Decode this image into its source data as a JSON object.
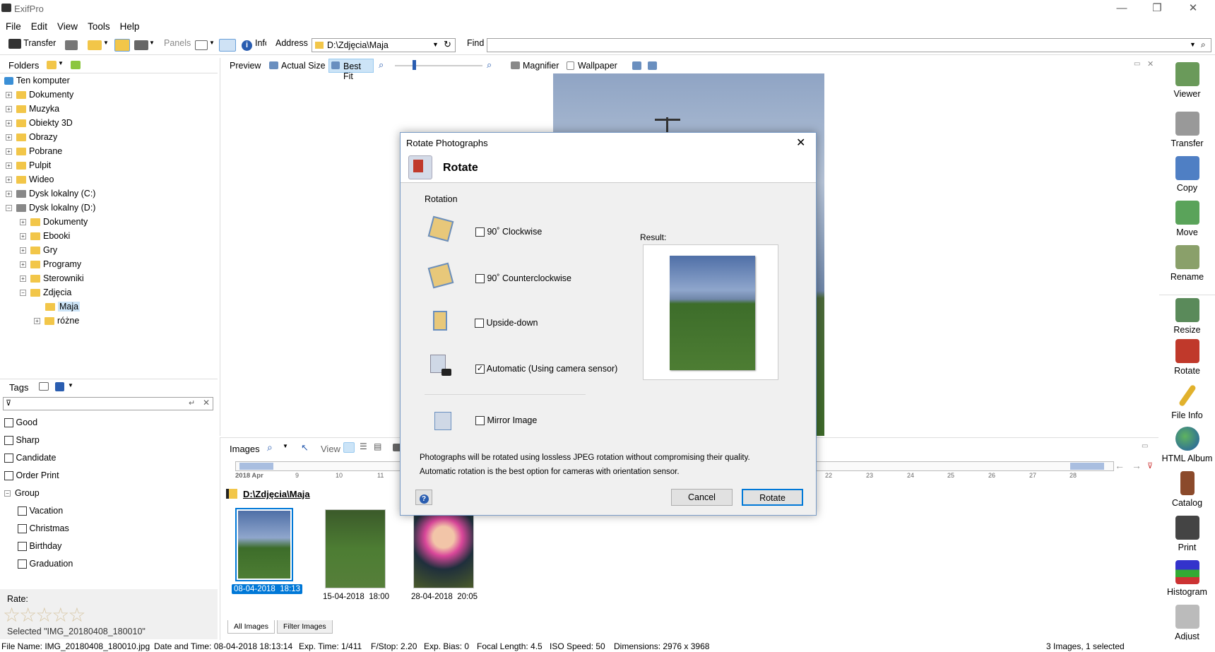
{
  "window": {
    "title": "ExifPro"
  },
  "menu": [
    "File",
    "Edit",
    "View",
    "Tools",
    "Help"
  ],
  "toolbar": {
    "transfer": "Transfer",
    "panels": "Panels",
    "info": "Info",
    "address_label": "Address",
    "address_value": "D:\\Zdjęcia\\Maja",
    "find_label": "Find",
    "find_value": ""
  },
  "folders": {
    "title": "Folders",
    "items": [
      "Ten komputer",
      "Dokumenty",
      "Muzyka",
      "Obiekty 3D",
      "Obrazy",
      "Pobrane",
      "Pulpit",
      "Wideo",
      "Dysk lokalny (C:)",
      "Dysk lokalny (D:)",
      "Dokumenty",
      "Ebooki",
      "Gry",
      "Programy",
      "Sterowniki",
      "Zdjęcia",
      "Maja",
      "różne"
    ]
  },
  "tags": {
    "title": "Tags",
    "filter_value": "",
    "items": [
      "Good",
      "Sharp",
      "Candidate",
      "Order Print"
    ],
    "group_label": "Group",
    "group_items": [
      "Vacation",
      "Christmas",
      "Birthday",
      "Graduation"
    ]
  },
  "rate": {
    "label": "Rate:",
    "stars": 0,
    "max": 5,
    "selected_text": "Selected \"IMG_20180408_180010\""
  },
  "preview": {
    "tab": "Preview",
    "actual_size": "Actual Size",
    "best_fit": "Best Fit",
    "magnifier": "Magnifier",
    "wallpaper": "Wallpaper"
  },
  "images": {
    "title": "Images",
    "view": "View",
    "timeline_month": "2018 Apr",
    "timeline_days": [
      "9",
      "10",
      "11",
      "22",
      "23",
      "24",
      "25",
      "26",
      "27",
      "28"
    ],
    "folder": "D:\\Zdjęcia\\Maja",
    "thumbs": [
      {
        "label": "08-04-2018  18:13",
        "selected": true
      },
      {
        "label": "15-04-2018  18:00",
        "selected": false
      },
      {
        "label": "28-04-2018  20:05",
        "selected": false
      }
    ],
    "tabs": [
      "All Images",
      "Filter Images"
    ]
  },
  "sidebar_right": [
    "Viewer",
    "Transfer",
    "Copy",
    "Move",
    "Rename",
    "Resize",
    "Rotate",
    "File Info",
    "HTML Album",
    "Catalog",
    "Print",
    "Histogram",
    "Adjust"
  ],
  "dialog": {
    "title": "Rotate Photographs",
    "header": "Rotate",
    "section": "Rotation",
    "options": [
      {
        "label": "90˚ Clockwise",
        "checked": false
      },
      {
        "label": "90˚ Counterclockwise",
        "checked": false
      },
      {
        "label": "Upside-down",
        "checked": false
      },
      {
        "label": "Automatic (Using camera sensor)",
        "checked": true
      },
      {
        "label": "Mirror Image",
        "checked": false
      }
    ],
    "result_label": "Result:",
    "note1": "Photographs will be rotated using lossless JPEG rotation without compromising their quality.",
    "note2": "Automatic rotation is the best option for cameras with orientation sensor.",
    "help": "?",
    "cancel": "Cancel",
    "rotate": "Rotate"
  },
  "status": {
    "file_name": "File Name: IMG_20180408_180010.jpg",
    "date_time": "Date and Time: 08-04-2018  18:13:14",
    "exp_time": "Exp. Time: 1/411",
    "fstop": "F/Stop: 2.20",
    "exp_bias": "Exp. Bias: 0",
    "focal": "Focal Length: 4.5",
    "iso": "ISO Speed: 50",
    "dimensions": "Dimensions: 2976 x 3968",
    "count": "3 Images, 1 selected"
  },
  "colors": {
    "selection": "#0078d7",
    "folder": "#f2c649",
    "accent": "#3366cc"
  }
}
